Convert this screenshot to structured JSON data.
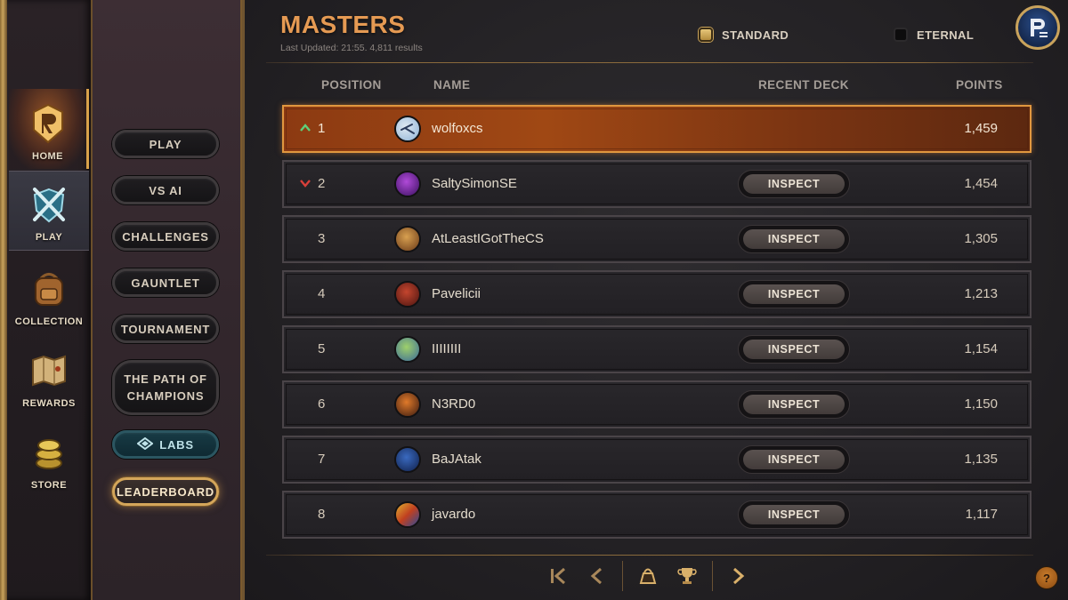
{
  "nav": {
    "items": [
      {
        "label": "HOME",
        "icon": "home-crest-icon"
      },
      {
        "label": "PLAY",
        "icon": "crossed-swords-shield-icon"
      },
      {
        "label": "COLLECTION",
        "icon": "backpack-icon"
      },
      {
        "label": "REWARDS",
        "icon": "map-scroll-icon"
      },
      {
        "label": "STORE",
        "icon": "coin-stack-icon"
      }
    ]
  },
  "modes": {
    "play": "PLAY",
    "vs_ai": "VS AI",
    "challenges": "CHALLENGES",
    "gauntlet": "GAUNTLET",
    "tournament": "TOURNAMENT",
    "path_line1": "THE PATH OF",
    "path_line2": "CHAMPIONS",
    "labs": "LABS",
    "leaderboard": "LEADERBOARD"
  },
  "header": {
    "title": "MASTERS",
    "subtitle": "Last Updated: 21:55. 4,811 results",
    "filters": [
      {
        "label": "STANDARD",
        "checked": true
      },
      {
        "label": "ETERNAL",
        "checked": false
      }
    ]
  },
  "columns": {
    "position": "POSITION",
    "name": "NAME",
    "recent_deck": "RECENT DECK",
    "points": "POINTS"
  },
  "inspect_label": "INSPECT",
  "rows": [
    {
      "position": "1",
      "name": "wolfoxcs",
      "points": "1,459",
      "trend": "up",
      "avatar_colors": [
        "#dfe9f2",
        "#8fb3d6"
      ]
    },
    {
      "position": "2",
      "name": "SaltySimonSE",
      "points": "1,454",
      "trend": "down",
      "avatar_colors": [
        "#b04ad8",
        "#3a1060"
      ]
    },
    {
      "position": "3",
      "name": "AtLeastIGotTheCS",
      "points": "1,305",
      "trend": "",
      "avatar_colors": [
        "#d8a050",
        "#6a3a18"
      ]
    },
    {
      "position": "4",
      "name": "Pavelicii",
      "points": "1,213",
      "trend": "",
      "avatar_colors": [
        "#c4452e",
        "#4a1410"
      ]
    },
    {
      "position": "5",
      "name": "IIIIIIII",
      "points": "1,154",
      "trend": "",
      "avatar_colors": [
        "#9ed06a",
        "#3a6a9a"
      ]
    },
    {
      "position": "6",
      "name": "N3RD0",
      "points": "1,150",
      "trend": "",
      "avatar_colors": [
        "#e07a2a",
        "#3a1a10"
      ]
    },
    {
      "position": "7",
      "name": "BaJAtak",
      "points": "1,135",
      "trend": "",
      "avatar_colors": [
        "#3a6ac0",
        "#10204a"
      ]
    },
    {
      "position": "8",
      "name": "javardo",
      "points": "1,117",
      "trend": "",
      "avatar_colors": [
        "#e0b030",
        "#2a4a9a"
      ]
    }
  ],
  "pager": {
    "icons": [
      "first-page-icon",
      "prev-page-icon",
      "bag-icon",
      "trophy-icon",
      "next-page-icon"
    ]
  },
  "help_label": "?",
  "colors": {
    "accent": "#e59a53",
    "gold": "#c9a35c",
    "first_row": "#a04814"
  }
}
